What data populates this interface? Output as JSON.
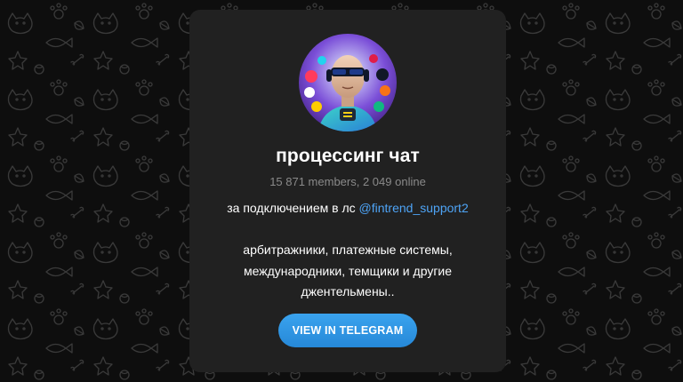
{
  "channel": {
    "title": "процессинг чат",
    "members_line": "15 871 members, 2 049 online",
    "description": {
      "line1_prefix": "за подключением в лс ",
      "line1_link": "@fintrend_support2",
      "line2": "арбитражники, платежные системы,",
      "line3": "международники, темщики и другие",
      "line4": "джентельмены.."
    },
    "button_label": "VIEW IN TELEGRAM"
  },
  "colors": {
    "background": "#0e0e0e",
    "card": "#212121",
    "link": "#4ea4f6",
    "button": "#2b8fe0"
  },
  "icons": {
    "avatar": "channel-avatar-robot-image",
    "background": "doodle-pattern"
  }
}
